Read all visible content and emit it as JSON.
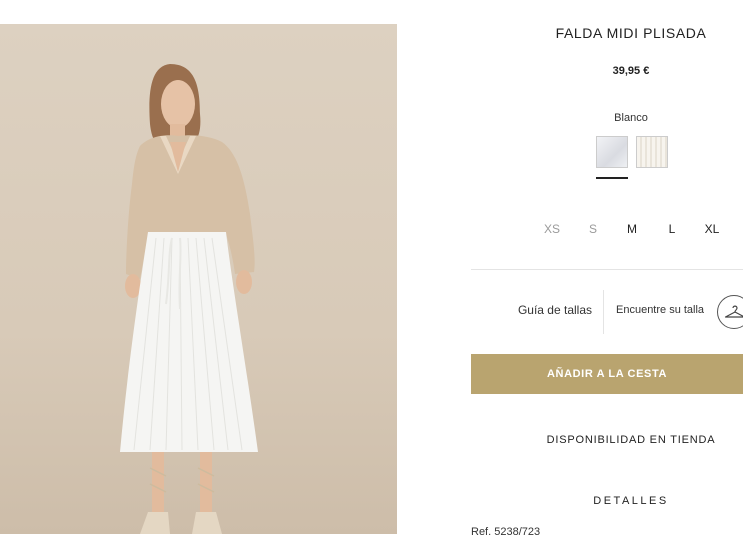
{
  "product": {
    "title": "FALDA MIDI PLISADA",
    "price": "39,95 €",
    "color_name": "Blanco",
    "sizes": [
      {
        "label": "XS",
        "available": false
      },
      {
        "label": "S",
        "available": false
      },
      {
        "label": "M",
        "available": true
      },
      {
        "label": "L",
        "available": true
      },
      {
        "label": "XL",
        "available": true
      }
    ],
    "size_guide_label": "Guía de tallas",
    "find_size_label": "Encuentre su talla",
    "add_to_cart_label": "AÑADIR A LA CESTA",
    "store_availability_label": "DISPONIBILIDAD EN TIENDA",
    "details_label": "DETALLES",
    "ref_text": "Ref. 5238/723"
  },
  "colors": {
    "accent": "#b9a46f",
    "photo_background": "#d8cab8"
  },
  "icons": {
    "fit_icon": "hanger-icon"
  }
}
